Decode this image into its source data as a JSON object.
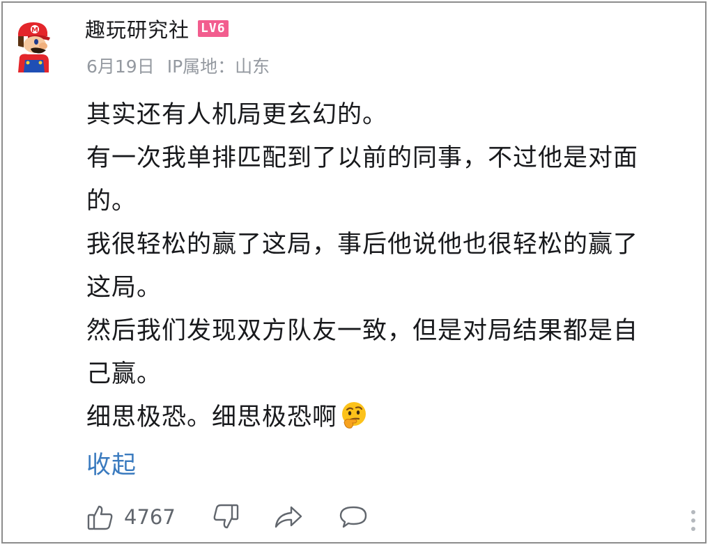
{
  "user": {
    "name": "趣玩研究社",
    "level_badge": "LV6",
    "avatar_icon": "mario-avatar-icon"
  },
  "meta": {
    "date": "6月19日",
    "ip_location": "IP属地：山东"
  },
  "comment": {
    "lines": [
      "其实还有人机局更玄幻的。",
      "有一次我单排匹配到了以前的同事，不过他是对面",
      "的。",
      "我很轻松的赢了这局，事后他说他也很轻松的赢了",
      "这局。",
      "然后我们发现双方队友一致，但是对局结果都是自",
      "己赢。",
      "细思极恐。细思极恐啊"
    ],
    "emoji": "thinking-face-emoji",
    "collapse_label": "收起"
  },
  "actions": {
    "like_count": "4767",
    "like_icon": "thumbs-up-icon",
    "dislike_icon": "thumbs-down-icon",
    "share_icon": "share-icon",
    "reply_icon": "comment-bubble-icon",
    "more_icon": "more-vertical-icon"
  },
  "colors": {
    "text_primary": "#18191c",
    "text_secondary": "#9499a0",
    "link": "#3b7bbf",
    "level_badge": "#f25d8e",
    "icon": "#61666d",
    "border": "#8c8c8c"
  }
}
